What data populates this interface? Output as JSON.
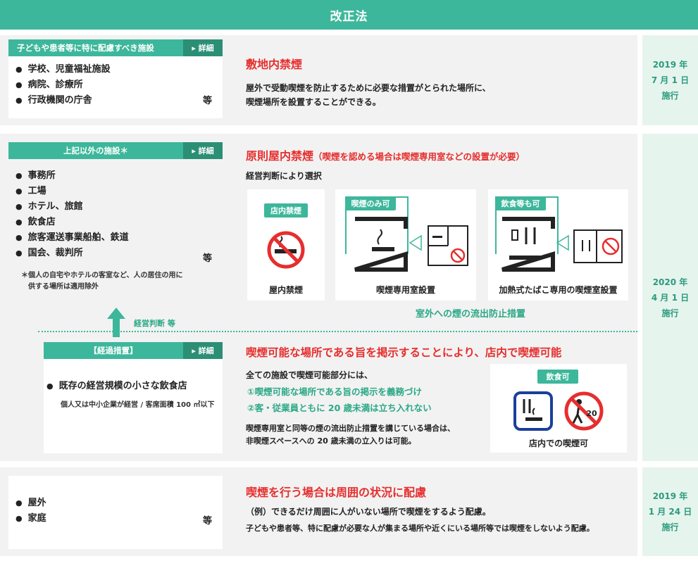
{
  "header": {
    "title": "改正法"
  },
  "section1": {
    "tag": "子どもや患者等に特に配慮すべき施設",
    "detail": "▸ 詳細",
    "items": [
      "学校、児童福祉施設",
      "病院、診療所",
      "行政機関の庁舎"
    ],
    "etc": "等",
    "headline": "敷地内禁煙",
    "desc1": "屋外で受動喫煙を防止するために必要な措置がとられた場所に、",
    "desc2": "喫煙場所を設置することができる。",
    "date_year": "2019 年",
    "date_md": "7 月 1 日",
    "date_label": "施行"
  },
  "section2": {
    "tag": "上記以外の施設＊",
    "detail": "▸ 詳細",
    "items": [
      "事務所",
      "工場",
      "ホテル、旅館",
      "飲食店",
      "旅客運送事業船舶、鉄道",
      "国会、裁判所"
    ],
    "etc": "等",
    "note1": "＊個人の自宅やホテルの客室など、人の居住の用に",
    "note2": "供する場所は適用除外",
    "arrow_label": "経営判断 等",
    "headline_main": "原則屋内禁煙",
    "headline_sub": "（喫煙を認める場合は喫煙専用室などの設置が必要）",
    "select_label": "経営判断により選択",
    "options": [
      {
        "tag": "店内禁煙",
        "caption": "屋内禁煙"
      },
      {
        "tag": "喫煙のみ可",
        "caption": "喫煙専用室設置"
      },
      {
        "tag": "飲食等も可",
        "caption": "加熱式たばこ専用の喫煙室設置"
      }
    ],
    "prevention": "室外への煙の流出防止措置",
    "transition": {
      "tag": "【経過措置】",
      "detail": "▸ 詳細",
      "item": "既存の経営規模の小さな飲食店",
      "sub": "個人又は中小企業が経営 / 客席面積 100 ㎡以下"
    },
    "headline2": "喫煙可能な場所である旨を掲示することにより、店内で喫煙可能",
    "all_facilities": "全ての施設で喫煙可能部分には、",
    "rule1": "①喫煙可能な場所である旨の掲示を義務づけ",
    "rule2": "②客・従業員ともに 20 歳未満は立ち入れない",
    "cond1": "喫煙専用室と同等の煙の流出防止措置を講じている場合は、",
    "cond2": "非喫煙スペースへの 20 歳未満の立入りは可能。",
    "smoking_tag": "飲食可",
    "age_mark": "20",
    "smoking_caption": "店内での喫煙可",
    "date_year": "2020 年",
    "date_md": "4 月 1 日",
    "date_label": "施行"
  },
  "section3": {
    "items": [
      "屋外",
      "家庭"
    ],
    "etc": "等",
    "headline": "喫煙を行う場合は周囲の状況に配慮",
    "example": "（例）できるだけ周囲に人がいない場所で喫煙をするよう配慮。",
    "desc": "子どもや患者等、特に配慮が必要な人が集まる場所や近くにいる場所等では喫煙をしないよう配慮。",
    "date_year": "2019 年",
    "date_md": "1 月 24 日",
    "date_label": "施行"
  },
  "colors": {
    "accent": "#3db79b",
    "red": "#e62e2e",
    "date_bg": "#e6f4ee"
  }
}
